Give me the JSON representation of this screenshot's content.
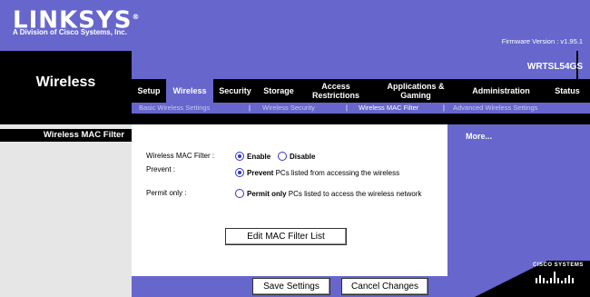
{
  "header": {
    "logo": "LINKSYS",
    "logo_registered": "®",
    "logo_sub": "A Division of Cisco Systems, Inc.",
    "firmware": "Firmware Version : v1.95.1",
    "model": "WRTSL54GS"
  },
  "section_title": "Wireless",
  "tabs": [
    {
      "label": "Setup"
    },
    {
      "label": "Wireless",
      "active": true
    },
    {
      "label": "Security"
    },
    {
      "label": "Storage"
    },
    {
      "label": "Access Restrictions"
    },
    {
      "label": "Applications & Gaming"
    },
    {
      "label": "Administration"
    },
    {
      "label": "Status"
    }
  ],
  "subtabs": [
    {
      "label": "Basic Wireless Settings"
    },
    {
      "label": "Wireless Security"
    },
    {
      "label": "Wireless MAC Filter",
      "active": true
    },
    {
      "label": "Advanced Wireless Settings"
    }
  ],
  "subtab_separator": "|",
  "left_title": "Wireless MAC Filter",
  "form": {
    "mac_filter_label": "Wireless MAC Filter :",
    "enable": "Enable",
    "disable": "Disable",
    "prevent_label": "Prevent :",
    "prevent_bold": "Prevent",
    "prevent_rest": " PCs listed from accessing the wireless",
    "permit_label": "Permit only :",
    "permit_bold": "Permit only",
    "permit_rest": " PCs listed to access the wireless network",
    "edit_button": "Edit MAC Filter List",
    "selected_filter": "Enable",
    "selected_mode": "Prevent"
  },
  "buttons": {
    "save": "Save Settings",
    "cancel": "Cancel Changes"
  },
  "right": {
    "more": "More...",
    "cisco": "CISCO SYSTEMS"
  },
  "colors": {
    "brand": "#6666cc",
    "band": "#000000",
    "left_panel": "#e6e6e6"
  }
}
